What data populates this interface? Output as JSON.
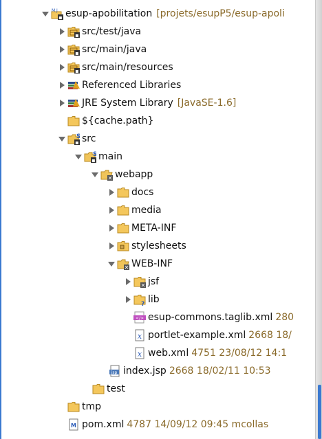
{
  "project": {
    "name": "esup-apobilitation",
    "location": "[projets/esupP5/esup-apoli"
  },
  "tree": [
    {
      "indent": 0,
      "twisty": "expanded",
      "icon": "project",
      "label": "esup-apobilitation",
      "extra": "[projets/esupP5/esup-apoli",
      "extra_kind": "bracket"
    },
    {
      "indent": 1,
      "twisty": "collapsed",
      "icon": "source-folder",
      "label": "src/test/java"
    },
    {
      "indent": 1,
      "twisty": "collapsed",
      "icon": "source-folder",
      "label": "src/main/java"
    },
    {
      "indent": 1,
      "twisty": "collapsed",
      "icon": "source-folder",
      "label": "src/main/resources"
    },
    {
      "indent": 1,
      "twisty": "collapsed",
      "icon": "library",
      "label": "Referenced Libraries"
    },
    {
      "indent": 1,
      "twisty": "collapsed",
      "icon": "library",
      "label": "JRE System Library",
      "extra": "[JavaSE-1.6]",
      "extra_kind": "bracket"
    },
    {
      "indent": 1,
      "twisty": "none",
      "icon": "folder",
      "label": "${cache.path}"
    },
    {
      "indent": 1,
      "twisty": "expanded",
      "icon": "folder-open-s",
      "label": "src"
    },
    {
      "indent": 2,
      "twisty": "expanded",
      "icon": "folder-open-s",
      "label": "main"
    },
    {
      "indent": 3,
      "twisty": "expanded",
      "icon": "folder-open-x",
      "label": "webapp"
    },
    {
      "indent": 4,
      "twisty": "collapsed",
      "icon": "folder",
      "label": "docs"
    },
    {
      "indent": 4,
      "twisty": "collapsed",
      "icon": "folder",
      "label": "media"
    },
    {
      "indent": 4,
      "twisty": "collapsed",
      "icon": "folder",
      "label": "META-INF"
    },
    {
      "indent": 4,
      "twisty": "collapsed",
      "icon": "folder-pkg",
      "label": "stylesheets"
    },
    {
      "indent": 4,
      "twisty": "expanded",
      "icon": "folder-open-x",
      "label": "WEB-INF"
    },
    {
      "indent": 5,
      "twisty": "collapsed",
      "icon": "folder-x",
      "label": "jsf"
    },
    {
      "indent": 5,
      "twisty": "collapsed",
      "icon": "folder-q",
      "label": "lib"
    },
    {
      "indent": 5,
      "twisty": "none",
      "icon": "xml-tag",
      "label": "esup-commons.taglib.xml",
      "extra": "280",
      "extra_kind": "meta"
    },
    {
      "indent": 5,
      "twisty": "none",
      "icon": "xml-file",
      "label": "portlet-example.xml",
      "extra": "2668  18/",
      "extra_kind": "meta"
    },
    {
      "indent": 5,
      "twisty": "none",
      "icon": "xml-file",
      "label": "web.xml",
      "extra": "4751  23/08/12 14:1",
      "extra_kind": "meta"
    },
    {
      "indent": 4,
      "twisty": "none",
      "icon": "jsp-file",
      "label": "index.jsp",
      "extra": "2668  18/02/11 10:53",
      "extra_kind": "meta",
      "shift": -1
    },
    {
      "indent": 2,
      "twisty": "none",
      "icon": "folder",
      "label": "test",
      "shift": 1
    },
    {
      "indent": 1,
      "twisty": "none",
      "icon": "folder",
      "label": "tmp"
    },
    {
      "indent": 1,
      "twisty": "none",
      "icon": "pom-file",
      "label": "pom.xml",
      "extra": "4787  14/09/12 09:45  mcollas",
      "extra_kind": "meta"
    }
  ]
}
